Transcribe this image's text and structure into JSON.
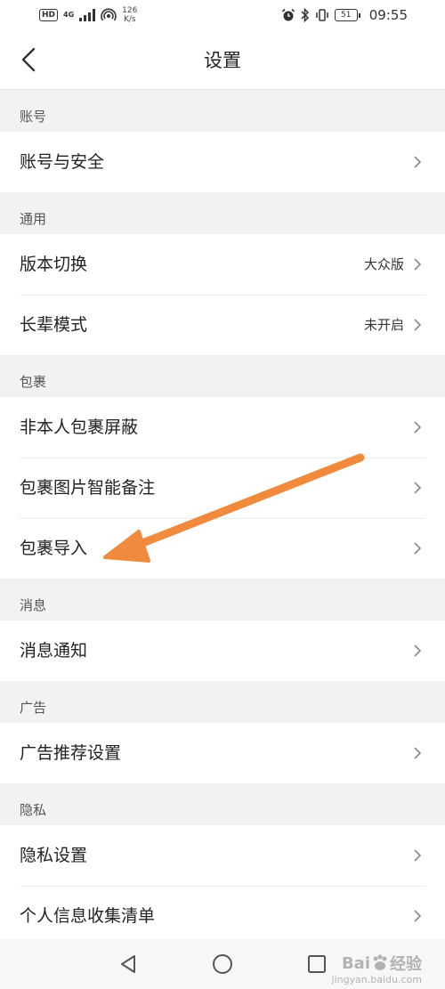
{
  "status_bar": {
    "hd": "HD",
    "network": "4G",
    "speed_value": "126",
    "speed_unit": "K/s",
    "battery": "51",
    "time": "09:55"
  },
  "header": {
    "title": "设置",
    "back_icon": "chevron-left-icon"
  },
  "sections": [
    {
      "label": "账号",
      "items": [
        {
          "label": "账号与安全",
          "value": ""
        }
      ]
    },
    {
      "label": "通用",
      "items": [
        {
          "label": "版本切换",
          "value": "大众版"
        },
        {
          "label": "长辈模式",
          "value": "未开启"
        }
      ]
    },
    {
      "label": "包裹",
      "items": [
        {
          "label": "非本人包裹屏蔽",
          "value": ""
        },
        {
          "label": "包裹图片智能备注",
          "value": ""
        },
        {
          "label": "包裹导入",
          "value": ""
        }
      ]
    },
    {
      "label": "消息",
      "items": [
        {
          "label": "消息通知",
          "value": ""
        }
      ]
    },
    {
      "label": "广告",
      "items": [
        {
          "label": "广告推荐设置",
          "value": ""
        }
      ]
    },
    {
      "label": "隐私",
      "items": [
        {
          "label": "隐私设置",
          "value": ""
        },
        {
          "label": "个人信息收集清单",
          "value": ""
        }
      ]
    }
  ],
  "annotation": {
    "color": "#f08a3c",
    "target": "包裹导入"
  },
  "watermark": {
    "brand": "Bai",
    "brand_suffix": "经验",
    "url": "jingyan.baidu.com"
  },
  "colors": {
    "background": "#f2f2f2",
    "card": "#ffffff",
    "text": "#222222",
    "section_text": "#555555"
  }
}
